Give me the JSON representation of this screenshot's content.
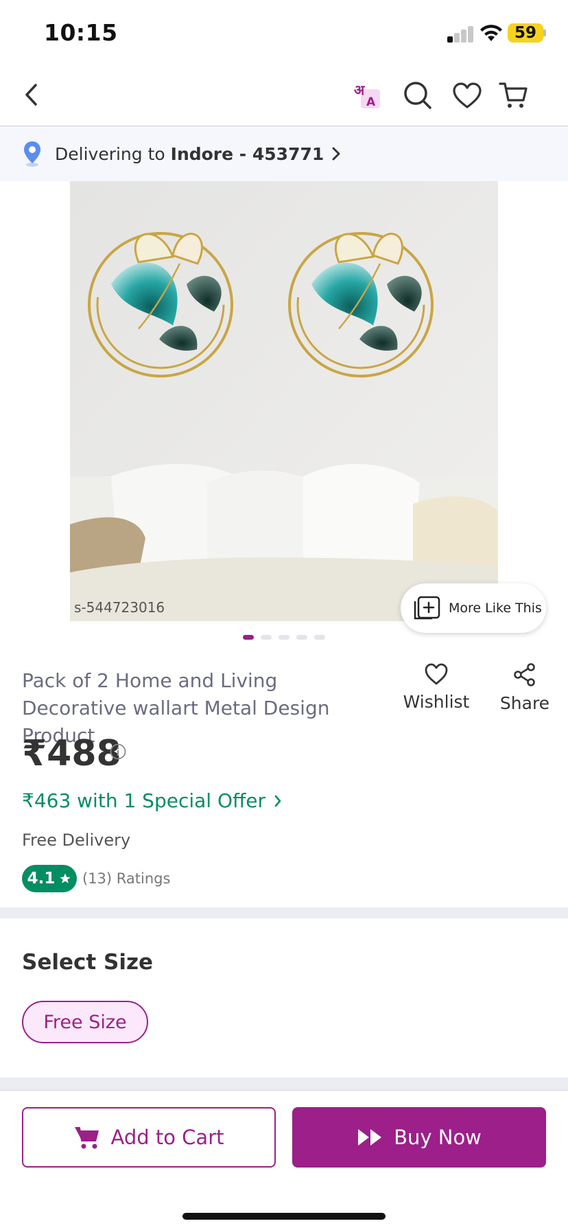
{
  "status_bar": {
    "time": "10:15",
    "battery": "59"
  },
  "header": {
    "icons": [
      "back-arrow-icon",
      "translate-icon",
      "search-icon",
      "heart-icon",
      "cart-icon"
    ],
    "translate_glyph_top": "अ",
    "translate_glyph_bottom": "A"
  },
  "delivery": {
    "prefix": "Delivering to",
    "location": "Indore - 453771"
  },
  "gallery": {
    "watermark": "s-544723016",
    "more_like_label": "More Like This",
    "image_count": 5,
    "active_index": 0
  },
  "product": {
    "title": "Pack of 2 Home and Living Decorative wallart Metal Design Product",
    "price": "₹488",
    "offer": "₹463 with 1 Special Offer",
    "free_delivery": "Free Delivery",
    "rating": "4.1",
    "rating_count": "(13) Ratings"
  },
  "actions": {
    "wishlist": "Wishlist",
    "share": "Share"
  },
  "size": {
    "heading": "Select Size",
    "selected": "Free Size"
  },
  "bottom_bar": {
    "add_to_cart": "Add to Cart",
    "buy_now": "Buy Now"
  },
  "colors": {
    "brand": "#9c1f8a",
    "offer_green": "#038d63",
    "rating_green": "#038d63"
  }
}
